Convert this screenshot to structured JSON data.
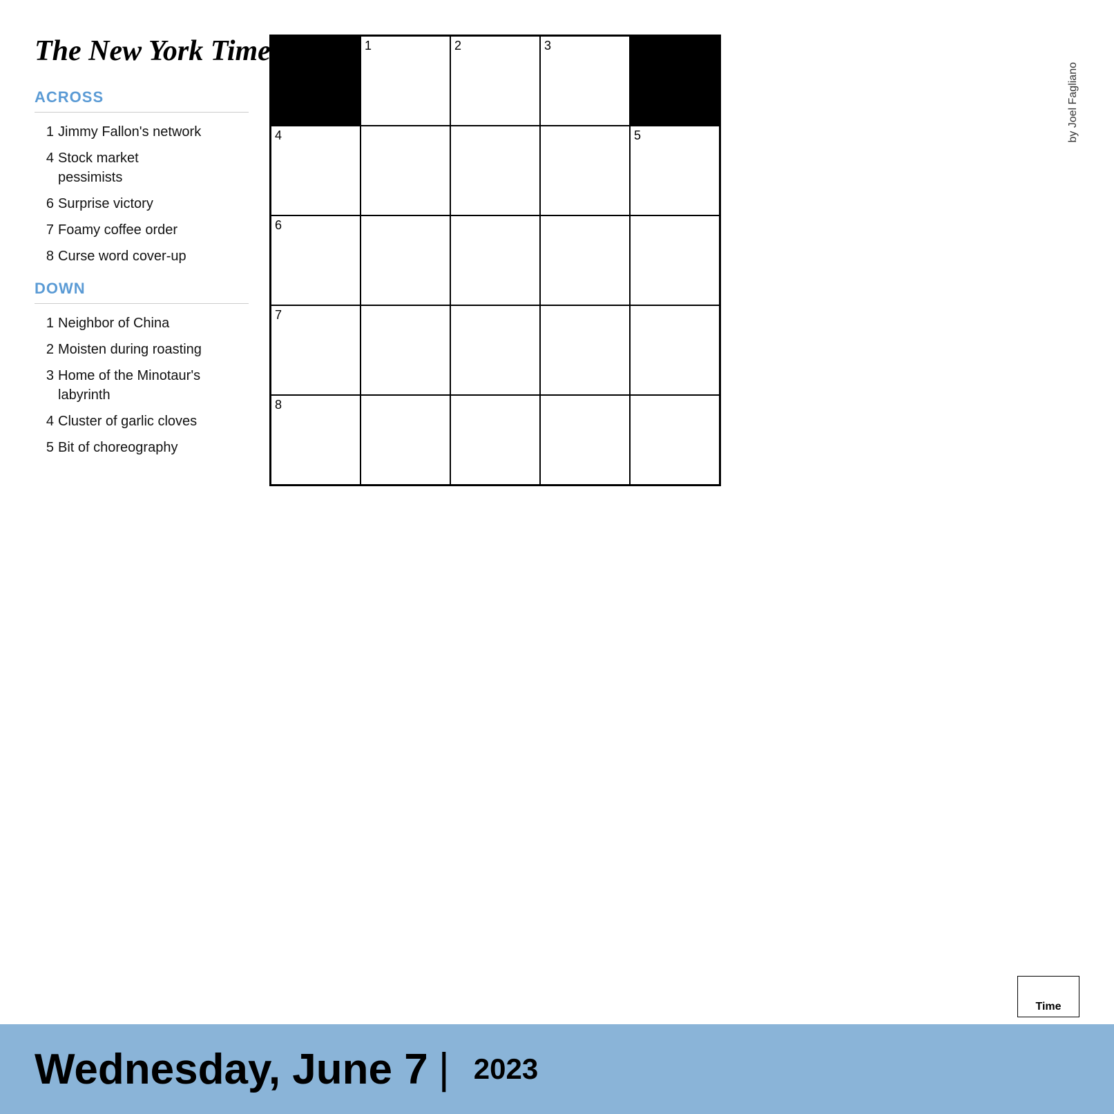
{
  "header": {
    "logo": "The New York Times",
    "byline": "by Joel Fagliano"
  },
  "clues": {
    "across_title": "ACROSS",
    "across": [
      {
        "number": "1",
        "text": "Jimmy Fallon's network"
      },
      {
        "number": "4",
        "text": "Stock market pessimists"
      },
      {
        "number": "6",
        "text": "Surprise victory"
      },
      {
        "number": "7",
        "text": "Foamy coffee order"
      },
      {
        "number": "8",
        "text": "Curse word cover-up"
      }
    ],
    "down_title": "DOWN",
    "down": [
      {
        "number": "1",
        "text": "Neighbor of China"
      },
      {
        "number": "2",
        "text": "Moisten during roasting"
      },
      {
        "number": "3",
        "text": "Home of the Minotaur's labyrinth"
      },
      {
        "number": "4",
        "text": "Cluster of garlic cloves"
      },
      {
        "number": "5",
        "text": "Bit of choreography"
      }
    ]
  },
  "grid": {
    "cells": [
      {
        "row": 0,
        "col": 0,
        "black": true,
        "number": ""
      },
      {
        "row": 0,
        "col": 1,
        "black": false,
        "number": "1"
      },
      {
        "row": 0,
        "col": 2,
        "black": false,
        "number": "2"
      },
      {
        "row": 0,
        "col": 3,
        "black": false,
        "number": "3"
      },
      {
        "row": 0,
        "col": 4,
        "black": true,
        "number": ""
      },
      {
        "row": 1,
        "col": 0,
        "black": false,
        "number": "4"
      },
      {
        "row": 1,
        "col": 1,
        "black": false,
        "number": ""
      },
      {
        "row": 1,
        "col": 2,
        "black": false,
        "number": ""
      },
      {
        "row": 1,
        "col": 3,
        "black": false,
        "number": ""
      },
      {
        "row": 1,
        "col": 4,
        "black": false,
        "number": "5"
      },
      {
        "row": 2,
        "col": 0,
        "black": false,
        "number": "6"
      },
      {
        "row": 2,
        "col": 1,
        "black": false,
        "number": ""
      },
      {
        "row": 2,
        "col": 2,
        "black": false,
        "number": ""
      },
      {
        "row": 2,
        "col": 3,
        "black": false,
        "number": ""
      },
      {
        "row": 2,
        "col": 4,
        "black": false,
        "number": ""
      },
      {
        "row": 3,
        "col": 0,
        "black": false,
        "number": "7"
      },
      {
        "row": 3,
        "col": 1,
        "black": false,
        "number": ""
      },
      {
        "row": 3,
        "col": 2,
        "black": false,
        "number": ""
      },
      {
        "row": 3,
        "col": 3,
        "black": false,
        "number": ""
      },
      {
        "row": 3,
        "col": 4,
        "black": false,
        "number": ""
      },
      {
        "row": 4,
        "col": 0,
        "black": false,
        "number": "8"
      },
      {
        "row": 4,
        "col": 1,
        "black": false,
        "number": ""
      },
      {
        "row": 4,
        "col": 2,
        "black": false,
        "number": ""
      },
      {
        "row": 4,
        "col": 3,
        "black": false,
        "number": ""
      },
      {
        "row": 4,
        "col": 4,
        "black": false,
        "number": ""
      }
    ]
  },
  "footer": {
    "date": "Wednesday, June 7",
    "separator": "|",
    "year": "2023",
    "time_label": "Time"
  }
}
